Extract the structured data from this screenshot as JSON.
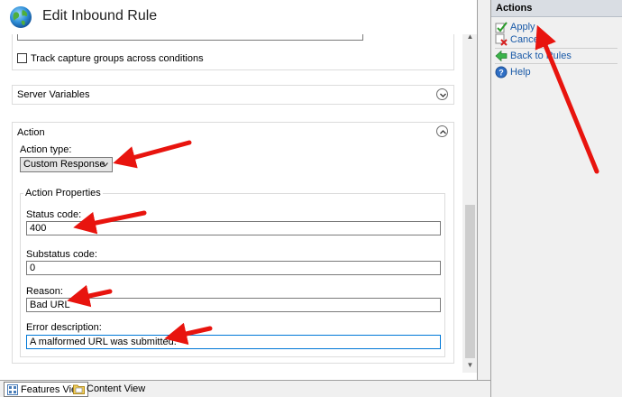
{
  "window": {
    "title": "Edit Inbound Rule"
  },
  "track_capture": {
    "label": "Track capture groups across conditions",
    "checked": false
  },
  "server_variables": {
    "title": "Server Variables"
  },
  "action_section": {
    "title": "Action",
    "action_type_label": "Action type:",
    "action_type_value": "Custom Response",
    "properties_title": "Action Properties",
    "status_code_label": "Status code:",
    "status_code_value": "400",
    "substatus_code_label": "Substatus code:",
    "substatus_code_value": "0",
    "reason_label": "Reason:",
    "reason_value": "Bad URL",
    "error_description_label": "Error description:",
    "error_description_value": "A malformed URL was submitted."
  },
  "bottom_tabs": {
    "features_view": "Features View",
    "content_view": "Content View"
  },
  "actions_pane": {
    "header": "Actions",
    "apply": "Apply",
    "cancel": "Cancel",
    "back_to_rules": "Back to Rules",
    "help": "Help"
  },
  "colors": {
    "annotation_arrow": "#e8140e",
    "link": "#1a5aa8",
    "focus_border": "#0078d7"
  },
  "icons": {
    "window": "globe-icon",
    "apply": "checkmark-icon",
    "cancel": "red-x-icon",
    "back": "green-back-arrow-icon",
    "help": "help-icon",
    "features_view": "features-view-icon",
    "content_view": "content-view-icon"
  }
}
